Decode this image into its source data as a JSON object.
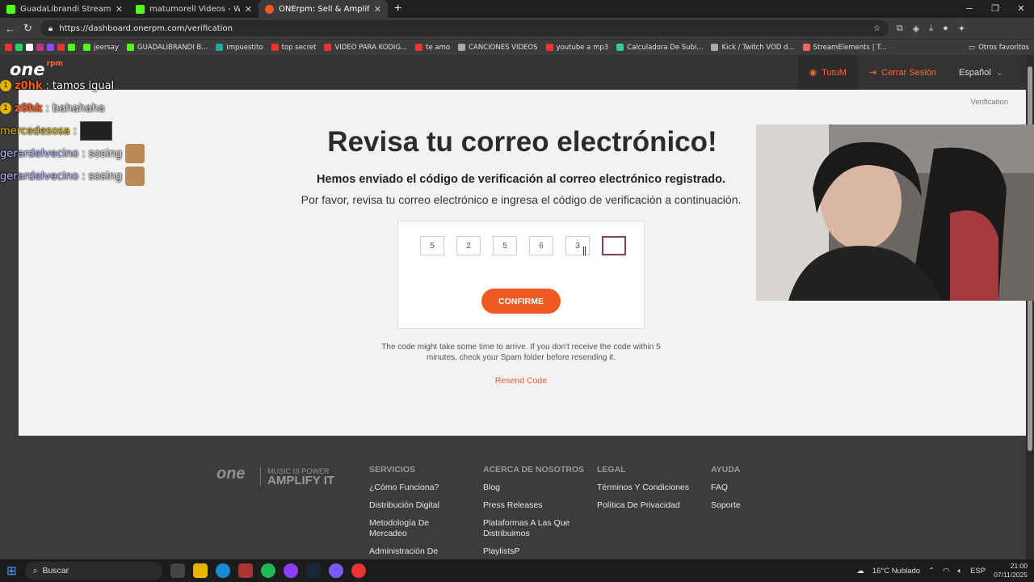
{
  "browser": {
    "tabs": [
      {
        "title": "GuadaLibrandi Stream - Wat",
        "color": "#53fc18"
      },
      {
        "title": "matumorell Videos - Watch",
        "color": "#53fc18"
      },
      {
        "title": "ONErpm: Sell & Amplify Your Mu",
        "color": "#f05a22"
      }
    ],
    "url": "https://dashboard.onerpm.com/verification",
    "bookmarks": [
      "jeersay",
      "GUADALIBRANDI B...",
      "impuestito",
      "top secret",
      "VIDEO PARA KODIG...",
      "te amo",
      "CANCIONES VIDEOS",
      "youtube a mp3",
      "Calculadora De Subi...",
      "Kick / Twitch VOD d...",
      "StreamElements | T..."
    ],
    "other_bookmarks": "Otros favoritos"
  },
  "site": {
    "logo": "one",
    "logo_small": "rpm",
    "nav": {
      "user": "TutuM",
      "logout": "Cerrar Sesión",
      "language": "Español"
    },
    "breadcrumb": "Verification",
    "title": "Revisa tu correo electrónico!",
    "subtitle": "Hemos enviado el código de verificación al correo electrónico registrado.",
    "instruction": "Por favor, revisa tu correo electrónico e ingresa el código de verificación a continuación.",
    "code_digits": [
      "5",
      "2",
      "5",
      "6",
      "3",
      ""
    ],
    "confirm_label": "CONFIRME",
    "note": "The code might take some time to arrive. If you don't receive the code within 5 minutes, check your Spam folder before resending it.",
    "resend_label": "Resend Code"
  },
  "footer": {
    "logo": "one",
    "tagline_top": "MUSIC IS POWER",
    "tagline_big": "AMPLIFY IT",
    "columns": [
      {
        "title": "SERVICIOS",
        "links": [
          "¿Cómo Funciona?",
          "Distribución Digital",
          "Metodología De Mercadeo",
          "Administración De"
        ]
      },
      {
        "title": "ACERCA DE NOSOTROS",
        "links": [
          "Blog",
          "Press Releases",
          "Plataformas A Las Que Distribuimos",
          "PlaylistsP"
        ]
      },
      {
        "title": "LEGAL",
        "links": [
          "Términos Y Condiciones",
          "Política De Privacidad"
        ]
      },
      {
        "title": "AYUDA",
        "links": [
          "FAQ",
          "Soporte"
        ]
      }
    ]
  },
  "chat": [
    {
      "user": "z0hk",
      "msg": "tamos igual"
    },
    {
      "user": "z0hk",
      "msg": "bahahaha"
    },
    {
      "user": "mercedesosa",
      "msg": ""
    },
    {
      "user": "gerardelvecino",
      "msg": "sosing"
    },
    {
      "user": "gerardelvecino",
      "msg": "sosing"
    }
  ],
  "taskbar": {
    "search_placeholder": "Buscar",
    "weather": "16°C  Nublado",
    "lang": "ESP",
    "time": "21:00",
    "date": "07/11/2025"
  }
}
